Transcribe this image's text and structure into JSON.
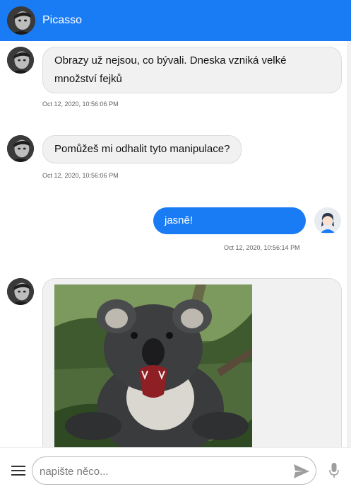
{
  "header": {
    "title": "Picasso",
    "avatar_icon": "picasso-avatar"
  },
  "messages": [
    {
      "sender": "bot",
      "text": "Obrazy už nejsou, co bývali. Dneska vzniká velké množství fejků",
      "timestamp": "Oct 12, 2020, 10:56:06 PM"
    },
    {
      "sender": "bot",
      "text": "Pomůžeš mi odhalit tyto manipulace?",
      "timestamp": "Oct 12, 2020, 10:56:06 PM"
    },
    {
      "sender": "user",
      "text": "jasně!",
      "timestamp": "Oct 12, 2020, 10:56:14 PM"
    },
    {
      "sender": "bot",
      "type": "image",
      "image_icon": "koala-photo"
    }
  ],
  "composer": {
    "placeholder": "napište něco...",
    "value": "",
    "menu_icon": "hamburger-menu-icon",
    "send_icon": "send-icon",
    "mic_icon": "microphone-icon"
  },
  "colors": {
    "accent": "#1a7cf5",
    "bubble_bg": "#f1f1f2",
    "bubble_border": "#dadce0"
  }
}
